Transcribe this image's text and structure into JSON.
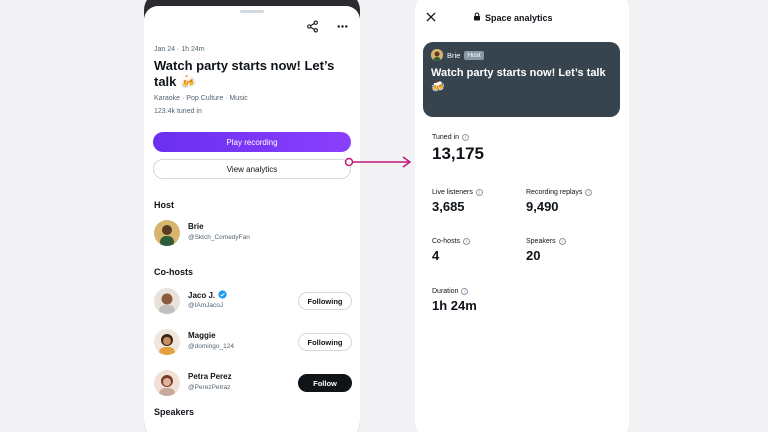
{
  "space": {
    "meta": "Jan 24 · 1h 24m",
    "title": "Watch party starts now! Let’s talk 🍻",
    "tags": "Karaoke · Pop Culture · Music",
    "tuned_in": "123.4k tuned in",
    "play_label": "Play recording",
    "analytics_label": "View analytics"
  },
  "host_section": {
    "heading": "Host",
    "name": "Brie",
    "handle": "@Sktch_ComedyFan"
  },
  "cohosts_section": {
    "heading": "Co-hosts",
    "people": [
      {
        "name": "Jaco J.",
        "handle": "@IAmJacoJ",
        "button": "Following",
        "verified": true
      },
      {
        "name": "Maggie",
        "handle": "@domingo_124",
        "button": "Following",
        "verified": false
      },
      {
        "name": "Petra Perez",
        "handle": "@PerezPetraz",
        "button": "Follow",
        "verified": false
      }
    ]
  },
  "speakers_section": {
    "heading": "Speakers"
  },
  "analytics": {
    "title": "Space analytics",
    "card_host_name": "Brie",
    "card_host_badge": "Host",
    "card_title": "Watch party starts now! Let’s talk 🍻",
    "tuned_in_label": "Tuned in",
    "tuned_in_value": "13,175",
    "live_listeners_label": "Live listeners",
    "live_listeners_value": "3,685",
    "recording_replays_label": "Recording replays",
    "recording_replays_value": "9,490",
    "cohosts_label": "Co-hosts",
    "cohosts_value": "4",
    "speakers_label": "Speakers",
    "speakers_value": "20",
    "duration_label": "Duration",
    "duration_value": "1h 24m"
  },
  "colors": {
    "accent_purple": "#7b36f7",
    "connector_magenta": "#c2187a",
    "card_bg": "#37444d",
    "verified_blue": "#1d9bf0"
  }
}
